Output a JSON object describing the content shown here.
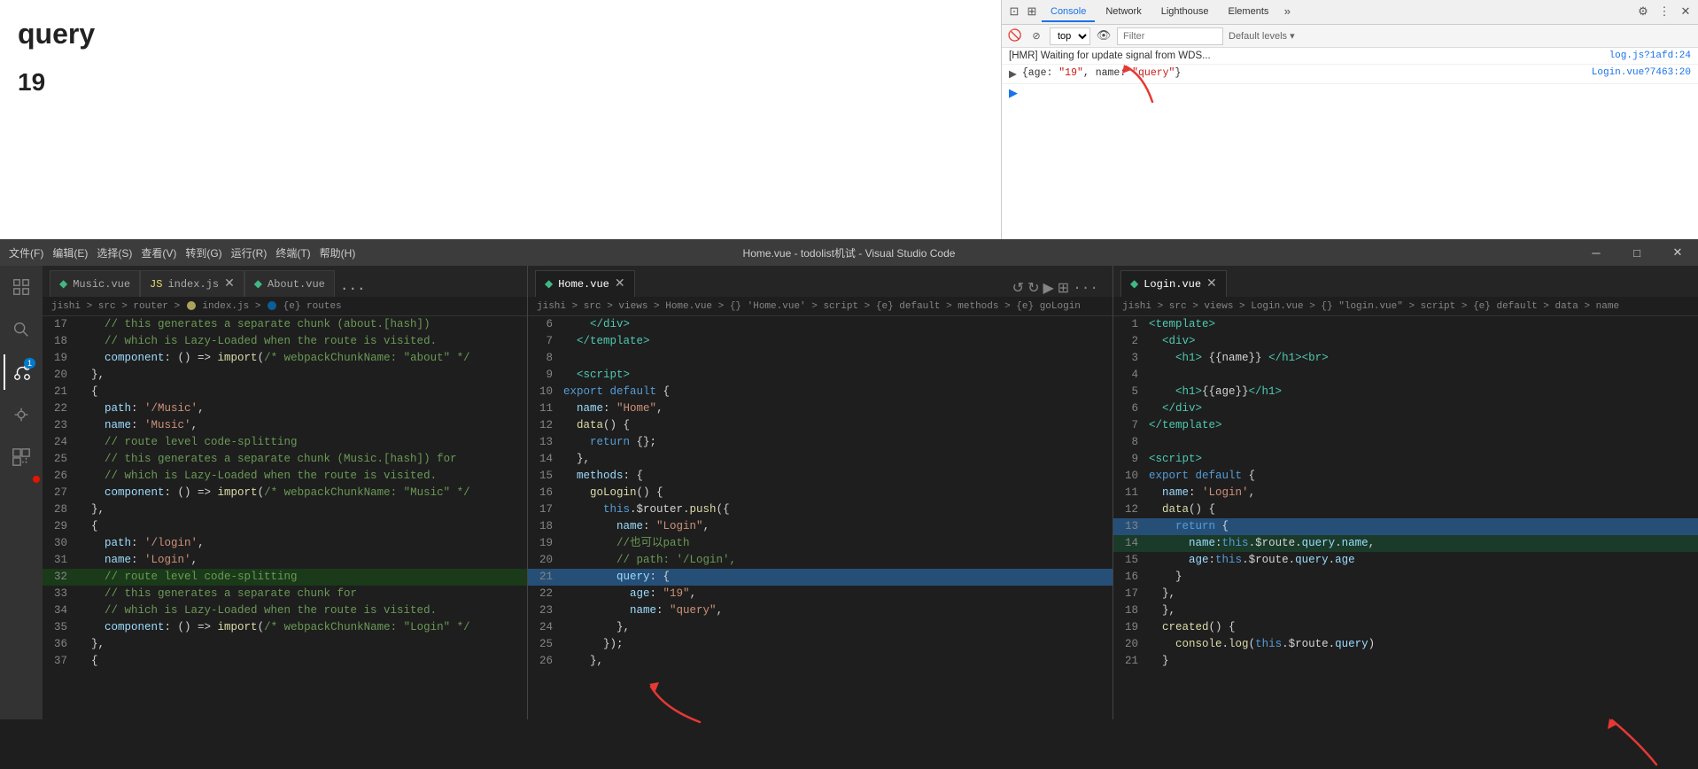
{
  "browser": {
    "query_label": "query",
    "number_label": "19"
  },
  "devtools": {
    "tabs": [
      {
        "label": "Console",
        "active": true
      },
      {
        "label": "Network",
        "active": false
      },
      {
        "label": "Lighthouse",
        "active": false
      },
      {
        "label": "Elements",
        "active": false
      }
    ],
    "toolbar": {
      "context": "top",
      "filter_placeholder": "Filter",
      "default_levels": "Default levels"
    },
    "console_lines": [
      {
        "type": "hmr",
        "text": "[HMR] Waiting for update signal from WDS...",
        "source": "log.js?1afd:24"
      },
      {
        "type": "obj",
        "text": "{age: \"19\", name: \"query\"}",
        "source": "Login.vue?7463:20"
      },
      {
        "type": "prompt",
        "text": ""
      }
    ]
  },
  "vscode": {
    "title": "Home.vue - todolist机试 - Visual Studio Code",
    "tabs_left": [
      {
        "label": "Music.vue",
        "type": "vue",
        "active": false
      },
      {
        "label": "index.js",
        "type": "js",
        "active": false,
        "dirty": false
      },
      {
        "label": "About.vue",
        "type": "vue",
        "active": false
      }
    ],
    "tabs_middle": [
      {
        "label": "Home.vue",
        "type": "vue",
        "active": true
      }
    ],
    "tabs_right": [
      {
        "label": "Login.vue",
        "type": "vue",
        "active": true
      }
    ],
    "breadcrumb_left": "jishi > src > router > index.js > {e} routes",
    "breadcrumb_middle": "jishi > src > views > Home.vue > {} 'Home.vue' > script > {e} default > methods > {e} goLogin",
    "breadcrumb_right": "jishi > src > views > Login.vue > {} 'login.vue' > script > {e} default > data > name",
    "code_left": [
      {
        "num": 17,
        "content": "    // this generates a separate chunk (about.[hash])",
        "class": "c-comment"
      },
      {
        "num": 18,
        "content": "    // which is Lazy-Loaded when the route is visited.",
        "class": "c-comment"
      },
      {
        "num": 19,
        "content": "    component: () => import(/* webpackChunkName: \"about\" */",
        "class": ""
      },
      {
        "num": 20,
        "content": "  },",
        "class": ""
      },
      {
        "num": 21,
        "content": "  {",
        "class": ""
      },
      {
        "num": 22,
        "content": "    path: '/Music',",
        "class": ""
      },
      {
        "num": 23,
        "content": "    name: 'Music',",
        "class": ""
      },
      {
        "num": 24,
        "content": "    // route level code-splitting",
        "class": "c-comment"
      },
      {
        "num": 25,
        "content": "    // this generates a separate chunk (Music.[hash]) for",
        "class": "c-comment"
      },
      {
        "num": 26,
        "content": "    // which is Lazy-Loaded when the route is visited.",
        "class": "c-comment"
      },
      {
        "num": 27,
        "content": "    component: () => import(/* webpackChunkName: \"Music\" */",
        "class": ""
      },
      {
        "num": 28,
        "content": "  },",
        "class": ""
      },
      {
        "num": 29,
        "content": "  {",
        "class": ""
      },
      {
        "num": 30,
        "content": "    path: '/login',",
        "class": ""
      },
      {
        "num": 31,
        "content": "    name: 'Login',",
        "class": ""
      },
      {
        "num": 32,
        "content": "    // route level code-splitting",
        "class": "highlight-green c-comment"
      },
      {
        "num": 33,
        "content": "    // this generates a separate chunk for",
        "class": "c-comment"
      },
      {
        "num": 34,
        "content": "    // which is Lazy-Loaded when the route is visited.",
        "class": "c-comment"
      },
      {
        "num": 35,
        "content": "    component: () => import(/* webpackChunkName: \"Login\" */",
        "class": ""
      },
      {
        "num": 36,
        "content": "  },",
        "class": ""
      },
      {
        "num": 37,
        "content": "  {",
        "class": ""
      }
    ],
    "code_middle": [
      {
        "num": 6,
        "content": "    </div>"
      },
      {
        "num": 7,
        "content": "  </template>"
      },
      {
        "num": 8,
        "content": ""
      },
      {
        "num": 9,
        "content": "  <script>"
      },
      {
        "num": 10,
        "content": "export default {"
      },
      {
        "num": 11,
        "content": "  name: \"Home\","
      },
      {
        "num": 12,
        "content": "  data() {"
      },
      {
        "num": 13,
        "content": "    return {};"
      },
      {
        "num": 14,
        "content": "  },"
      },
      {
        "num": 15,
        "content": "  methods: {"
      },
      {
        "num": 16,
        "content": "    goLogin() {"
      },
      {
        "num": 17,
        "content": "      this.$router.push({"
      },
      {
        "num": 18,
        "content": "        name: \"Login\","
      },
      {
        "num": 19,
        "content": "        //也可以path"
      },
      {
        "num": 20,
        "content": "        // path: '/Login',"
      },
      {
        "num": 21,
        "content": "        query: {",
        "highlight": true
      },
      {
        "num": 22,
        "content": "          age: \"19\","
      },
      {
        "num": 23,
        "content": "          name: \"query\","
      },
      {
        "num": 24,
        "content": "        },"
      },
      {
        "num": 25,
        "content": "      });"
      },
      {
        "num": 26,
        "content": "    },"
      }
    ],
    "code_right": [
      {
        "num": 1,
        "content": "<template>"
      },
      {
        "num": 2,
        "content": "  <div>"
      },
      {
        "num": 3,
        "content": "    <h1> {{name}} </h1><br>"
      },
      {
        "num": 4,
        "content": ""
      },
      {
        "num": 5,
        "content": "    <h1>{{age}}</h1>"
      },
      {
        "num": 6,
        "content": "  </div>"
      },
      {
        "num": 7,
        "content": "</template>"
      },
      {
        "num": 8,
        "content": ""
      },
      {
        "num": 9,
        "content": "<script>"
      },
      {
        "num": 10,
        "content": "export default {"
      },
      {
        "num": 11,
        "content": "  name: 'Login',"
      },
      {
        "num": 12,
        "content": "  data() {"
      },
      {
        "num": 13,
        "content": "    return {",
        "highlight": true
      },
      {
        "num": 14,
        "content": "      name:this.$route.query.name,",
        "highlight": true
      },
      {
        "num": 15,
        "content": "      age:this.$route.query.age"
      },
      {
        "num": 16,
        "content": "    }"
      },
      {
        "num": 17,
        "content": "  },"
      },
      {
        "num": 18,
        "content": "  },"
      },
      {
        "num": 19,
        "content": "  created() {"
      },
      {
        "num": 20,
        "content": "    console.log(this.$route.query)"
      },
      {
        "num": 21,
        "content": "  }"
      }
    ]
  }
}
